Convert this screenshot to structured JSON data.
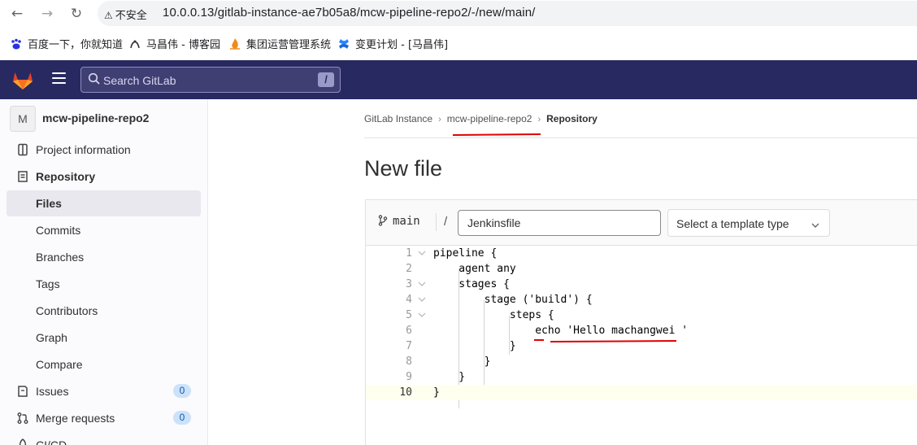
{
  "browser": {
    "back_icon": "arrow-left-icon",
    "forward_icon": "arrow-right-icon",
    "reload_icon": "reload-icon",
    "insecure_label": "不安全",
    "url": "10.0.0.13/gitlab-instance-ae7b05a8/mcw-pipeline-repo2/-/new/main/",
    "bookmarks": [
      {
        "label": "百度一下，你就知道",
        "icon": "baidu-paw-icon"
      },
      {
        "label": "马昌伟 - 博客园",
        "icon": "cnblogs-icon"
      },
      {
        "label": "集团运营管理系统",
        "icon": "flame-icon"
      },
      {
        "label": "变更计划 - [马昌伟]",
        "icon": "confluence-icon"
      }
    ]
  },
  "header": {
    "search_placeholder": "Search GitLab",
    "search_shortcut": "/",
    "brand_color": "#292961"
  },
  "sidebar": {
    "project_avatar": "M",
    "project_name": "mcw-pipeline-repo2",
    "items": [
      {
        "label": "Project information",
        "icon": "project-info-icon"
      },
      {
        "label": "Repository",
        "icon": "repository-icon"
      },
      {
        "label": "Files"
      },
      {
        "label": "Commits"
      },
      {
        "label": "Branches"
      },
      {
        "label": "Tags"
      },
      {
        "label": "Contributors"
      },
      {
        "label": "Graph"
      },
      {
        "label": "Compare"
      },
      {
        "label": "Issues",
        "icon": "issues-icon",
        "count": "0"
      },
      {
        "label": "Merge requests",
        "icon": "merge-request-icon",
        "count": "0"
      },
      {
        "label": "CI/CD",
        "icon": "rocket-icon"
      }
    ]
  },
  "breadcrumb": {
    "items": [
      "GitLab Instance",
      "mcw-pipeline-repo2",
      "Repository"
    ]
  },
  "page": {
    "title": "New file"
  },
  "editor": {
    "branch": "main",
    "path_separator": "/",
    "filename": "Jenkinsfile",
    "template_placeholder": "Select a template type",
    "lines": [
      {
        "num": "1",
        "text": "pipeline {"
      },
      {
        "num": "2",
        "text": "    agent any"
      },
      {
        "num": "3",
        "text": "    stages {"
      },
      {
        "num": "4",
        "text": "        stage ('build') {"
      },
      {
        "num": "5",
        "text": "            steps {"
      },
      {
        "num": "6",
        "text": "                echo 'Hello machangwei '"
      },
      {
        "num": "7",
        "text": "            }"
      },
      {
        "num": "8",
        "text": "        }"
      },
      {
        "num": "9",
        "text": "    }"
      },
      {
        "num": "10",
        "text": "}"
      }
    ]
  },
  "annotation_color": "#e00000"
}
